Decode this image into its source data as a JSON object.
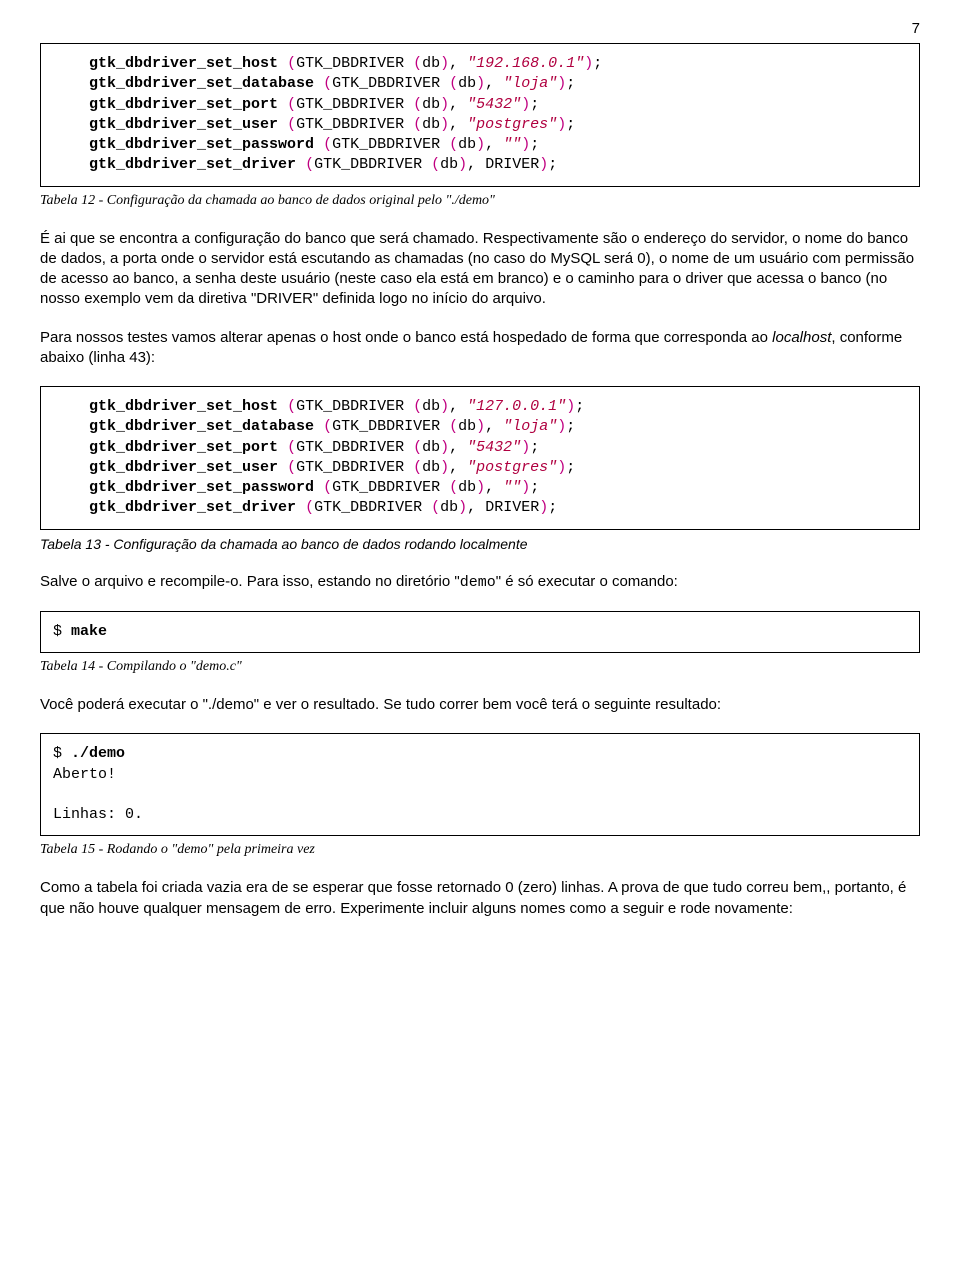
{
  "page": {
    "number": "7"
  },
  "code1": {
    "l1": {
      "fn": "gtk_dbdriver_set_host",
      "mid": "GTK_DBDRIVER ",
      "arg": "db",
      "str": "\"192.168.0.1\""
    },
    "l2": {
      "fn": "gtk_dbdriver_set_database",
      "mid": "GTK_DBDRIVER ",
      "arg": "db",
      "str": "\"loja\""
    },
    "l3": {
      "fn": "gtk_dbdriver_set_port",
      "mid": "GTK_DBDRIVER ",
      "arg": "db",
      "str": "\"5432\""
    },
    "l4": {
      "fn": "gtk_dbdriver_set_user",
      "mid": "GTK_DBDRIVER ",
      "arg": "db",
      "str": "\"postgres\""
    },
    "l5": {
      "fn": "gtk_dbdriver_set_password",
      "mid": "GTK_DBDRIVER ",
      "arg": "db",
      "str": "\"\""
    },
    "l6": {
      "fn": "gtk_dbdriver_set_driver",
      "mid": "GTK_DBDRIVER ",
      "arg": "db",
      "const": "DRIVER"
    }
  },
  "caption1": "Tabela 12 - Configuração da chamada ao banco de dados original pelo \"./demo\"",
  "para1": "É ai que se encontra a configuração do banco que será chamado. Respectivamente são o endereço do servidor, o nome do banco de dados, a porta onde o servidor está escutando as chamadas (no caso do MySQL será 0), o nome de um usuário com permissão de acesso ao banco, a senha deste usuário (neste caso ela está em branco) e o caminho para o driver que acessa o banco (no nosso exemplo vem da diretiva \"DRIVER\" definida logo no início do arquivo.",
  "para2a": "Para nossos testes vamos alterar apenas o host onde o banco está hospedado de forma que corresponda ao ",
  "para2b": "localhost",
  "para2c": ", conforme abaixo (linha 43):",
  "code2": {
    "l1": {
      "fn": "gtk_dbdriver_set_host",
      "mid": "GTK_DBDRIVER ",
      "arg": "db",
      "str": "\"127.0.0.1\""
    },
    "l2": {
      "fn": "gtk_dbdriver_set_database",
      "mid": "GTK_DBDRIVER ",
      "arg": "db",
      "str": "\"loja\""
    },
    "l3": {
      "fn": "gtk_dbdriver_set_port",
      "mid": "GTK_DBDRIVER ",
      "arg": "db",
      "str": "\"5432\""
    },
    "l4": {
      "fn": "gtk_dbdriver_set_user",
      "mid": "GTK_DBDRIVER ",
      "arg": "db",
      "str": "\"postgres\""
    },
    "l5": {
      "fn": "gtk_dbdriver_set_password",
      "mid": "GTK_DBDRIVER ",
      "arg": "db",
      "str": "\"\""
    },
    "l6": {
      "fn": "gtk_dbdriver_set_driver",
      "mid": "GTK_DBDRIVER ",
      "arg": "db",
      "const": "DRIVER"
    }
  },
  "caption2": "Tabela 13 - Configuração da chamada ao banco de dados rodando localmente",
  "para3a": "Salve o arquivo e recompile-o. Para isso, estando no diretório \"",
  "para3b": "demo",
  "para3c": "\" é só executar o comando:",
  "code3": {
    "prompt": "$ ",
    "cmd": "make"
  },
  "caption3": "Tabela 14 - Compilando o \"demo.c\"",
  "para4": "Você poderá executar o \"./demo\" e ver o resultado. Se tudo correr bem você terá o seguinte resultado:",
  "code4": {
    "prompt": "$ ",
    "cmd": "./demo",
    "out1": "Aberto!",
    "out2": "Linhas: 0."
  },
  "caption4": "Tabela 15 - Rodando o \"demo\" pela primeira vez",
  "para5": "Como a tabela foi criada vazia era de se esperar que fosse retornado 0 (zero) linhas. A prova de que tudo correu bem,, portanto, é que não houve qualquer mensagem de erro. Experimente incluir alguns nomes como a seguir e rode novamente:"
}
